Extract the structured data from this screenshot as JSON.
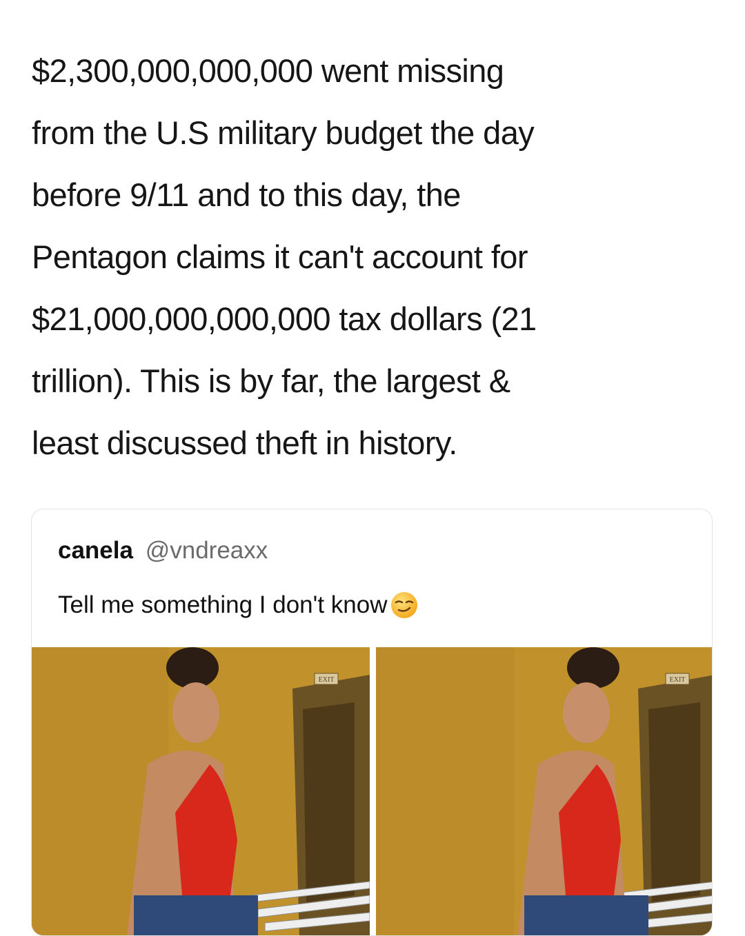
{
  "post": {
    "lines": [
      "$2,300,000,000,000 went missing",
      "from the U.S military budget the day",
      "before 9/11 and to this day, the",
      "Pentagon claims it can't account for",
      "$21,000,000,000,000 tax dollars (21",
      "trillion). This is by far, the largest &",
      "least discussed theft in history."
    ]
  },
  "quote": {
    "display_name": "canela",
    "handle": "@vndreaxx",
    "text": "Tell me something I don't know",
    "emoji": "smirking-face-emoji"
  },
  "photos": {
    "sign_text": "EXIT",
    "icon": "photo-of-person-on-stairs"
  },
  "colors": {
    "text": "#161616",
    "handle": "#6b6b6b",
    "card_border": "#e3e3e3",
    "wall": "#c99a2e",
    "top_red": "#d8281c",
    "jeans": "#2f4a78"
  }
}
